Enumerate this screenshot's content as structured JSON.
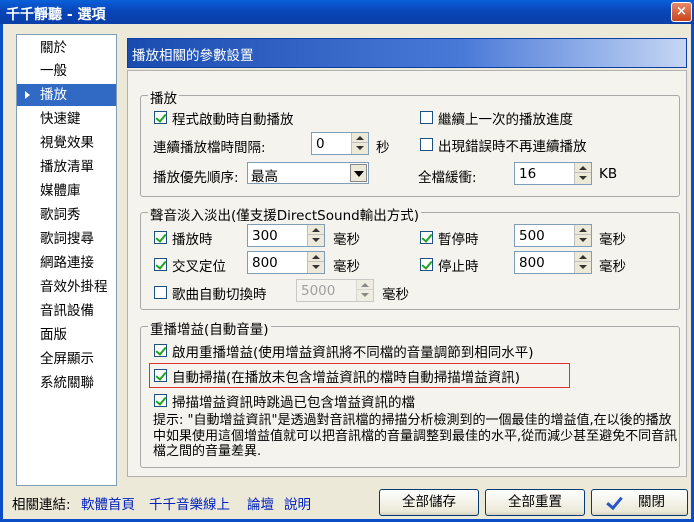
{
  "window": {
    "title": "千千靜聽 - 選項",
    "close_glyph": "×"
  },
  "sidebar": {
    "items": [
      {
        "label": "關於"
      },
      {
        "label": "一般"
      },
      {
        "label": "播放"
      },
      {
        "label": "快速鍵"
      },
      {
        "label": "視覺效果"
      },
      {
        "label": "播放清單"
      },
      {
        "label": "媒體庫"
      },
      {
        "label": "歌詞秀"
      },
      {
        "label": "歌詞搜尋"
      },
      {
        "label": "網路連接"
      },
      {
        "label": "音效外掛程"
      },
      {
        "label": "音訊設備"
      },
      {
        "label": "面版"
      },
      {
        "label": "全屏顯示"
      },
      {
        "label": "系統關聯"
      }
    ],
    "selected": "播放"
  },
  "header": {
    "title": "播放相關的參數設置"
  },
  "playback": {
    "legend": "播放",
    "autoplay_label": "程式啟動時自動播放",
    "resume_label": "繼續上一次的播放進度",
    "interval_label": "連續播放檔時間隔:",
    "interval_value": "0",
    "interval_unit": "秒",
    "no_continue_on_error_label": "出現錯誤時不再連續播放",
    "priority_label": "播放優先順序:",
    "priority_value": "最高",
    "buffer_label": "全檔緩衝:",
    "buffer_value": "16",
    "buffer_unit": "KB"
  },
  "fade": {
    "legend": "聲音淡入淡出(僅支援DirectSound輸出方式)",
    "play_label": "播放時",
    "play_value": "300",
    "pause_label": "暫停時",
    "pause_value": "500",
    "seek_label": "交叉定位",
    "seek_value": "800",
    "stop_label": "停止時",
    "stop_value": "800",
    "auto_switch_label": "歌曲自動切換時",
    "auto_switch_value": "5000",
    "unit": "毫秒"
  },
  "replaygain": {
    "legend": "重播增益(自動音量)",
    "enable_label": "啟用重播增益(使用增益資訊將不同檔的音量調節到相同水平)",
    "autoscan_label": "自動掃描(在播放未包含增益資訊的檔時自動掃描增益資訊)",
    "skip_label": "掃描增益資訊時跳過已包含增益資訊的檔",
    "hint": "提示: \"自動增益資訊\"是透過對音訊檔的掃描分析檢測到的一個最佳的增益值,在以後的播放中如果使用這個增益值就可以把音訊檔的音量調整到最佳的水平,從而減少甚至避免不同音訊檔之間的音量差異."
  },
  "footer": {
    "related_label": "相關連結:",
    "links": [
      "軟體首頁",
      "千千音樂線上",
      "論壇",
      "說明"
    ],
    "save_all": "全部儲存",
    "reset_all": "全部重置",
    "close": "關閉"
  }
}
